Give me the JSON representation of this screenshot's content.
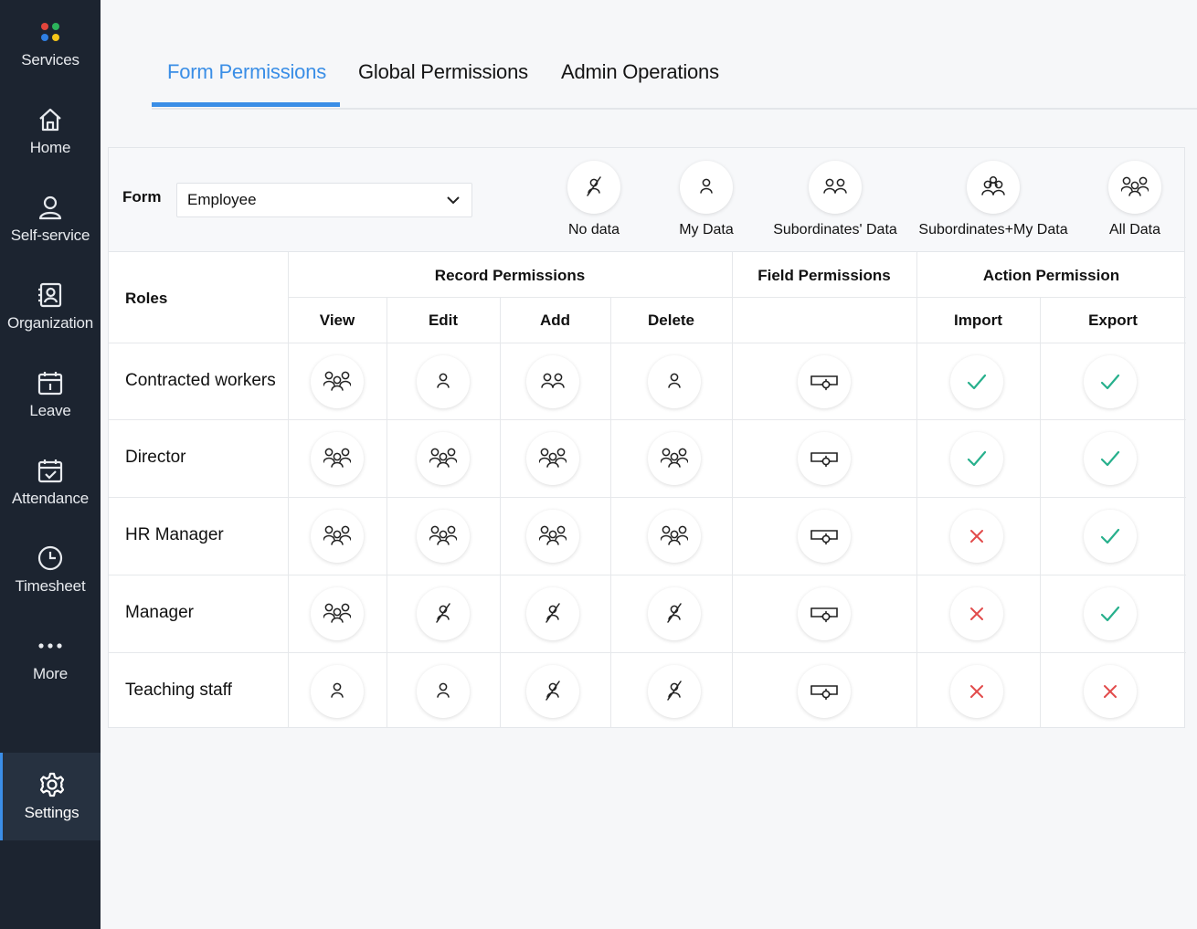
{
  "sidebar": {
    "items": [
      {
        "label": "Services",
        "icon": "services-dots-icon"
      },
      {
        "label": "Home",
        "icon": "home-icon"
      },
      {
        "label": "Self-service",
        "icon": "user-icon"
      },
      {
        "label": "Organization",
        "icon": "organization-icon"
      },
      {
        "label": "Leave",
        "icon": "calendar-icon"
      },
      {
        "label": "Attendance",
        "icon": "calendar-check-icon"
      },
      {
        "label": "Timesheet",
        "icon": "clock-icon"
      },
      {
        "label": "More",
        "icon": "more-dots-icon"
      },
      {
        "label": "Settings",
        "icon": "gear-icon",
        "active": true
      }
    ]
  },
  "tabs": [
    {
      "label": "Form Permissions",
      "active": true
    },
    {
      "label": "Global Permissions"
    },
    {
      "label": "Admin Operations"
    }
  ],
  "filter": {
    "form_label": "Form",
    "selected_form": "Employee"
  },
  "legend": [
    {
      "label": "No data",
      "icon": "no-data-icon"
    },
    {
      "label": "My Data",
      "icon": "my-data-icon"
    },
    {
      "label": "Subordinates' Data",
      "icon": "subordinates-data-icon"
    },
    {
      "label": "Subordinates+My Data",
      "icon": "subordinates-my-data-icon"
    },
    {
      "label": "All Data",
      "icon": "all-data-icon"
    }
  ],
  "table": {
    "roles_header": "Roles",
    "groups": {
      "record": "Record Permissions",
      "field": "Field Permissions",
      "action": "Action Permission"
    },
    "columns": {
      "view": "View",
      "edit": "Edit",
      "add": "Add",
      "delete": "Delete",
      "import": "Import",
      "export": "Export"
    },
    "rows": [
      {
        "role": "Contracted workers",
        "view": "all",
        "edit": "my",
        "add": "sub",
        "delete": "my",
        "import": "yes",
        "export": "yes"
      },
      {
        "role": "Director",
        "view": "all",
        "edit": "all",
        "add": "all",
        "delete": "all",
        "import": "yes",
        "export": "yes"
      },
      {
        "role": "HR Manager",
        "view": "all",
        "edit": "all",
        "add": "all",
        "delete": "all",
        "import": "no",
        "export": "yes"
      },
      {
        "role": "Manager",
        "view": "all",
        "edit": "none",
        "add": "none",
        "delete": "none",
        "import": "no",
        "export": "yes"
      },
      {
        "role": "Teaching staff",
        "view": "my",
        "edit": "my",
        "add": "none",
        "delete": "none",
        "import": "no",
        "export": "no"
      }
    ]
  },
  "colors": {
    "accent": "#3a8ee6",
    "check": "#27b08c",
    "cross": "#e24b4b",
    "sidebar_bg": "#1c2430"
  }
}
